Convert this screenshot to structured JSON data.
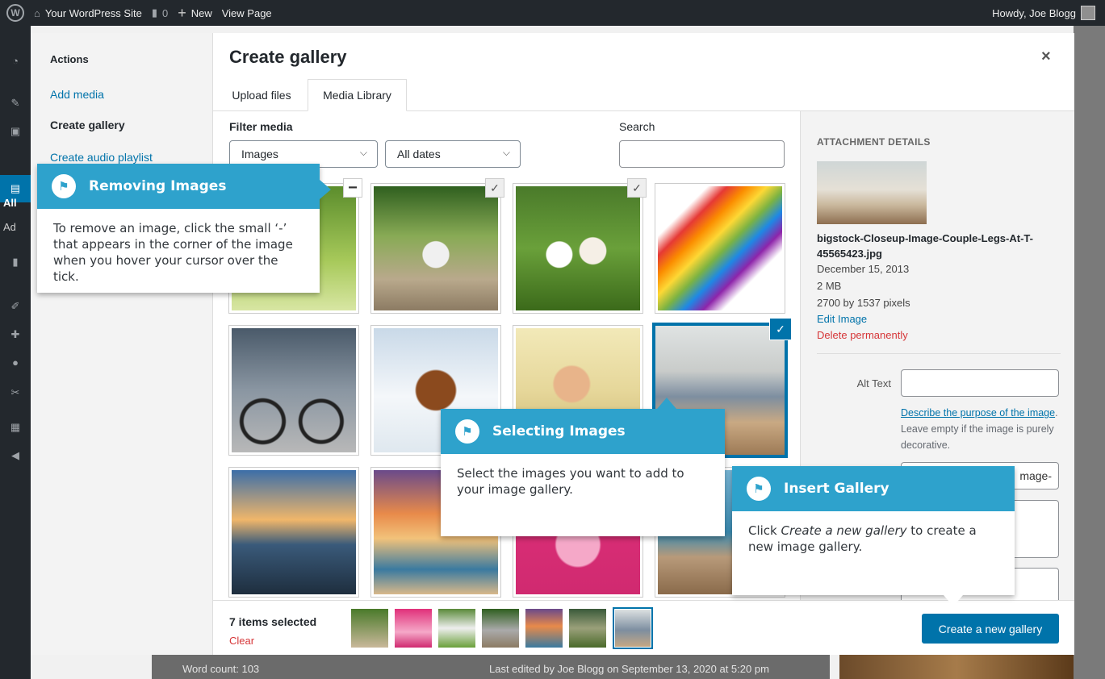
{
  "adminbar": {
    "wp_logo": "W",
    "site_name": "Your WordPress Site",
    "comments_count": "0",
    "new_label": "New",
    "view_page": "View Page",
    "howdy": "Howdy, Joe Blogg"
  },
  "admin_menu": {
    "sub_all": "All",
    "sub_add": "Ad"
  },
  "modal": {
    "actions_heading": "Actions",
    "menu_items": [
      "Add media",
      "Create gallery",
      "Create audio playlist"
    ],
    "title": "Create gallery",
    "close_glyph": "×",
    "tabs": [
      "Upload files",
      "Media Library"
    ]
  },
  "filters": {
    "label": "Filter media",
    "type_value": "Images",
    "date_value": "All dates",
    "search_label": "Search",
    "search_placeholder": ""
  },
  "attachment": {
    "heading": "ATTACHMENT DETAILS",
    "filename": "bigstock-Closeup-Image-Couple-Legs-At-T-45565423.jpg",
    "date": "December 15, 2013",
    "size": "2 MB",
    "dimensions": "2700 by 1537 pixels",
    "edit_link": "Edit Image",
    "delete_link": "Delete permanently",
    "alt_label": "Alt Text",
    "alt_value": "",
    "describe_link": "Describe the purpose of the image",
    "describe_rest": ". Leave empty if the image is purely decorative.",
    "title_value_fragment": "mage-"
  },
  "toolbar": {
    "count": "7 items selected",
    "clear": "Clear",
    "button": "Create a new gallery"
  },
  "tours": {
    "removing": {
      "title": "Removing Images",
      "body": "To remove an image, click the small ‘-’ that appears in the corner of the image when you hover your cursor over the tick."
    },
    "selecting": {
      "title": "Selecting Images",
      "body": "Select the images you want to add to your image gallery."
    },
    "insert": {
      "title": "Insert Gallery",
      "body_pre": "Click ",
      "body_em": "Create a new gallery",
      "body_post": " to create a new image gallery."
    }
  },
  "footer": {
    "word_count": "Word count: 103",
    "last_edited": "Last edited by Joe Blogg on September 13, 2020 at 5:20 pm"
  },
  "colors": {
    "accent": "#0073aa",
    "tour_header": "#2ea2cc",
    "delete": "#d63638",
    "admin_bg": "#23282d"
  },
  "library_images": [
    {
      "name": "grass-image",
      "state": "hover-minus"
    },
    {
      "name": "kitten-image",
      "state": "checked"
    },
    {
      "name": "puppies-image",
      "state": "checked"
    },
    {
      "name": "pencils-image",
      "state": "none"
    },
    {
      "name": "bicycle-image",
      "state": "none"
    },
    {
      "name": "horse-image",
      "state": "none"
    },
    {
      "name": "woman-headphones-image",
      "state": "none"
    },
    {
      "name": "beach-legs-image",
      "state": "selected"
    },
    {
      "name": "lighthouse-image",
      "state": "none"
    },
    {
      "name": "sunset-waves-image",
      "state": "none"
    },
    {
      "name": "woman-pink-image",
      "state": "none"
    },
    {
      "name": "pier-boats-image",
      "state": "none"
    }
  ]
}
